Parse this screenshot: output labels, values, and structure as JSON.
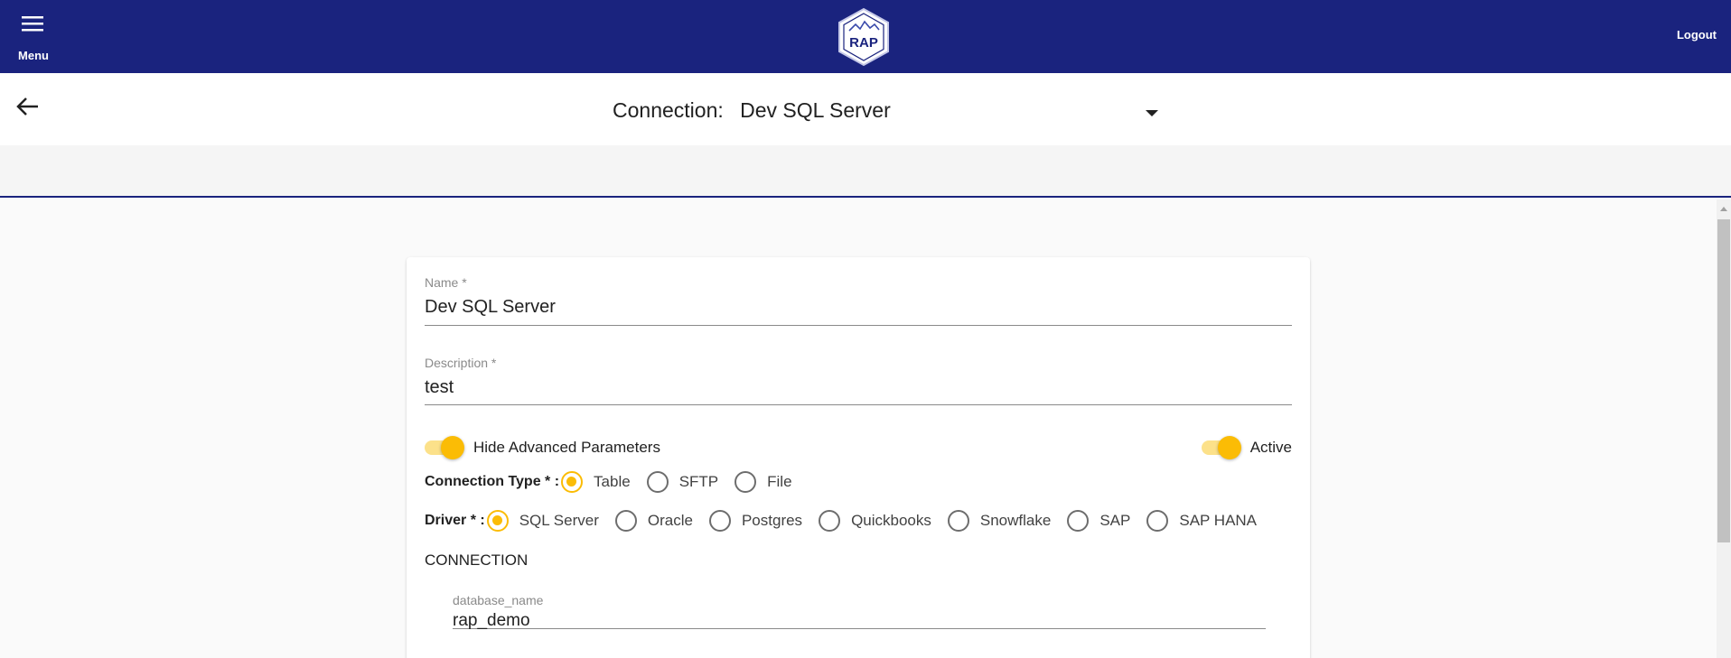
{
  "appbar": {
    "menu_label": "Menu",
    "logo_text": "RAP",
    "logout_label": "Logout",
    "bg_color": "#1a237e"
  },
  "header": {
    "prefix": "Connection:",
    "selected_connection": "Dev SQL Server"
  },
  "form": {
    "name": {
      "label": "Name *",
      "value": "Dev SQL Server"
    },
    "description": {
      "label": "Description *",
      "value": "test"
    },
    "hide_advanced": {
      "label": "Hide Advanced Parameters",
      "on": true
    },
    "active": {
      "label": "Active",
      "on": true
    },
    "connection_type": {
      "label": "Connection Type * :",
      "options": [
        "Table",
        "SFTP",
        "File"
      ],
      "selected": "Table"
    },
    "driver": {
      "label": "Driver * :",
      "options": [
        "SQL Server",
        "Oracle",
        "Postgres",
        "Quickbooks",
        "Snowflake",
        "SAP",
        "SAP HANA"
      ],
      "selected": "SQL Server"
    },
    "connection_section": "CONNECTION",
    "database_name": {
      "label": "database_name",
      "value": "rap_demo"
    }
  },
  "colors": {
    "accent": "#fbbc05",
    "primary": "#1a237e"
  },
  "icons": {
    "menu": "hamburger-icon",
    "back": "arrow-left-icon",
    "caret": "caret-down-icon"
  }
}
